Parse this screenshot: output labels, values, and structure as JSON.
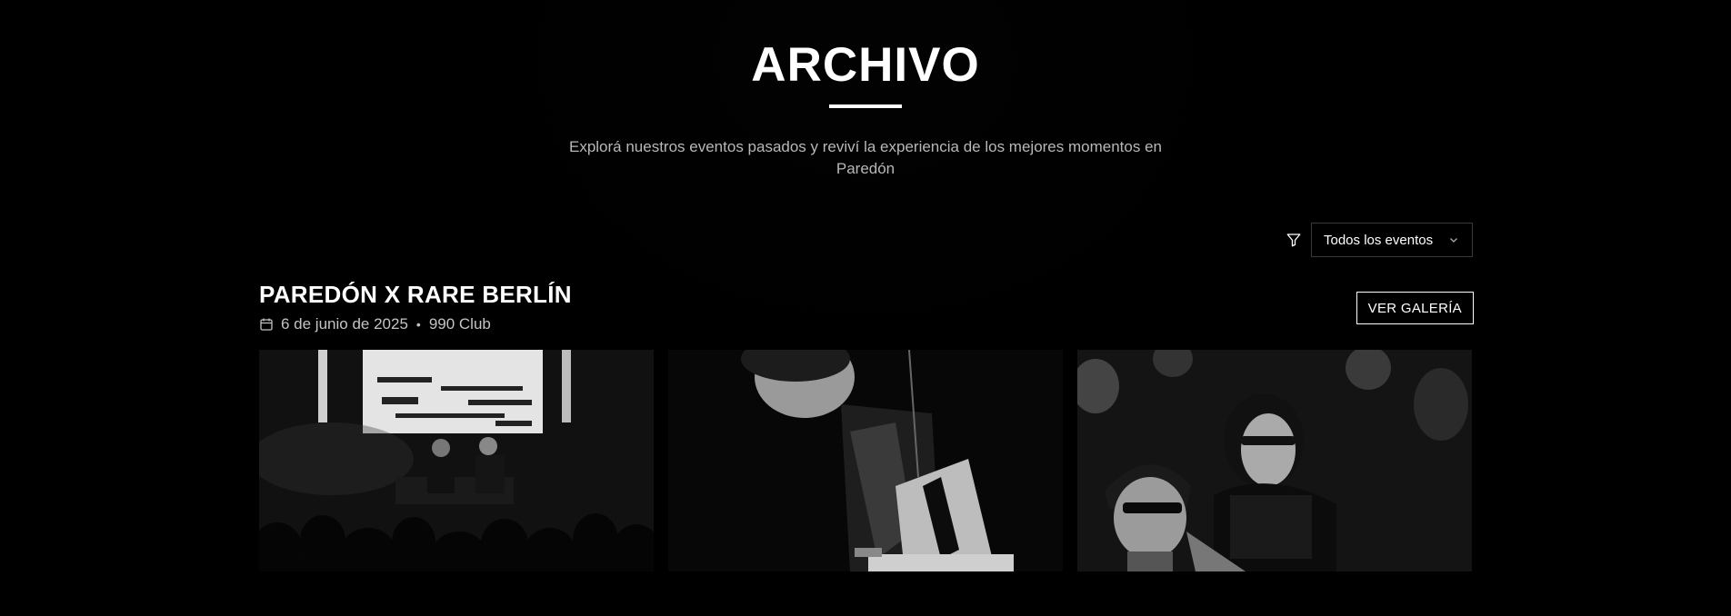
{
  "hero": {
    "title": "ARCHIVO",
    "subtitle": "Explorá nuestros eventos pasados y reviví la experiencia de los mejores momentos en Paredón"
  },
  "filter": {
    "icon": "filter-icon",
    "selected": "Todos los eventos"
  },
  "events": [
    {
      "title": "PAREDÓN X RARE BERLÍN",
      "date": "6 de junio de 2025",
      "venue": "990 Club",
      "gallery_label": "VER GALERÍA",
      "photos": [
        {
          "icon": "dj-stage-photo"
        },
        {
          "icon": "dj-closeup-photo"
        },
        {
          "icon": "crowd-photo"
        }
      ]
    }
  ]
}
